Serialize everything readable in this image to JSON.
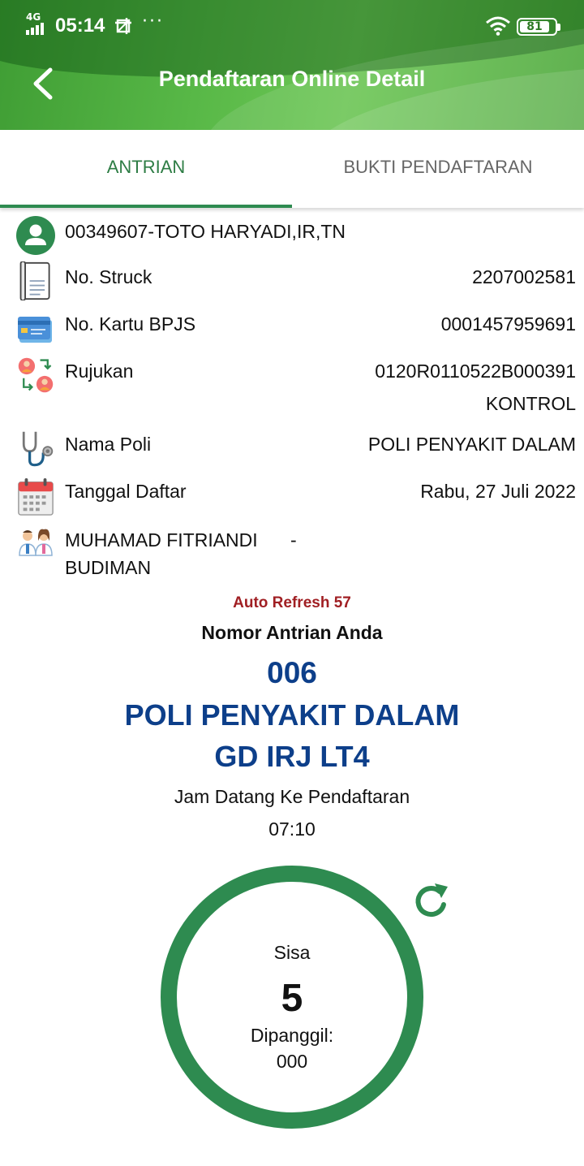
{
  "status_bar": {
    "network": "4G",
    "time": "05:14",
    "dots": "···",
    "battery": "81"
  },
  "header": {
    "title": "Pendaftaran Online Detail",
    "back_icon": "chevron-left-icon"
  },
  "tabs": [
    {
      "label": "ANTRIAN",
      "active": true
    },
    {
      "label": "BUKTI PENDAFTARAN",
      "active": false
    }
  ],
  "patient": {
    "id_name": "00349607-TOTO HARYADI,IR,TN",
    "icon": "person-icon"
  },
  "details": {
    "struck": {
      "label": "No. Struck",
      "value": "2207002581",
      "icon": "receipt-icon"
    },
    "bpjs": {
      "label": "No. Kartu BPJS",
      "value": "0001457959691",
      "icon": "card-icon"
    },
    "rujukan": {
      "label": "Rujukan",
      "value": "0120R0110522B000391",
      "value2": "KONTROL",
      "icon": "referral-icon"
    },
    "poli": {
      "label": "Nama Poli",
      "value": "POLI PENYAKIT DALAM",
      "icon": "stethoscope-icon"
    },
    "tanggal": {
      "label": "Tanggal Daftar",
      "value": "Rabu, 27 Juli 2022",
      "icon": "calendar-icon"
    },
    "dokter": {
      "line1": "MUHAMAD FITRIANDI",
      "line2": "BUDIMAN",
      "value": "-",
      "icon": "doctors-icon"
    }
  },
  "queue": {
    "auto_refresh": "Auto Refresh 57",
    "title": "Nomor Antrian Anda",
    "number": "006",
    "poli": "POLI PENYAKIT DALAM",
    "gedung": "GD IRJ LT4",
    "jam_label": "Jam Datang Ke Pendaftaran",
    "jam_value": "07:10"
  },
  "counter": {
    "sisa_label": "Sisa",
    "sisa_value": "5",
    "dipanggil_label": "Dipanggil:",
    "dipanggil_value": "000",
    "refresh_icon": "refresh-icon"
  },
  "colors": {
    "primary_green": "#2e8b50",
    "header_green": "#58b847",
    "queue_blue": "#0d3f8a",
    "refresh_red": "#a01f23"
  }
}
